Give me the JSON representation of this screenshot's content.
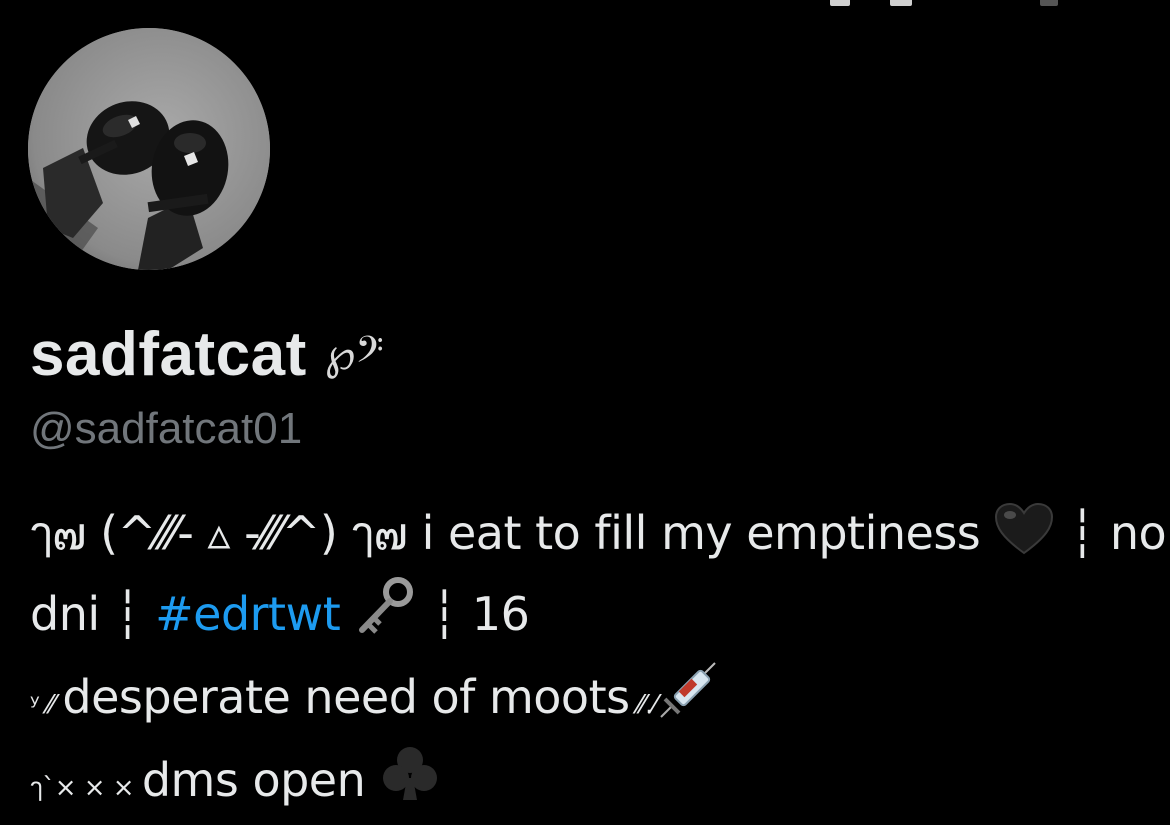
{
  "profile": {
    "display_name": "sadfatcat",
    "display_name_decoration": "℘𝄢",
    "handle": "@sadfatcat01",
    "avatar_icon": "avatar-photo-black-shoes"
  },
  "bio": {
    "line1": {
      "prefix": "ๅ๗ (^⁄⁄⁄‐ ▵ ‐⁄⁄⁄^) ๅ๗",
      "text": " i eat to fill my emptiness ",
      "heart_icon": "black-heart-icon",
      "separator": " ┆ ",
      "tail": "no"
    },
    "line2": {
      "text": "dni",
      "separator1": " ┆ ",
      "hashtag": "#edrtwt",
      "key_icon": "old-key-icon",
      "separator2": " ┆ ",
      "age": "16"
    },
    "line3": {
      "prefix": "ʸ  ⁄⁄ ",
      "text": "desperate need of moots",
      "suffix": " ⁄⁄.⁄",
      "syringe_icon": "syringe-icon"
    },
    "line4": {
      "prefix": "ๅ`× × × ",
      "text": "dms open ",
      "club_icon": "club-suit-icon"
    }
  },
  "colors": {
    "background": "#000000",
    "primary_text": "#e7e9ea",
    "secondary_text": "#71767b",
    "link": "#1d9bf0"
  }
}
